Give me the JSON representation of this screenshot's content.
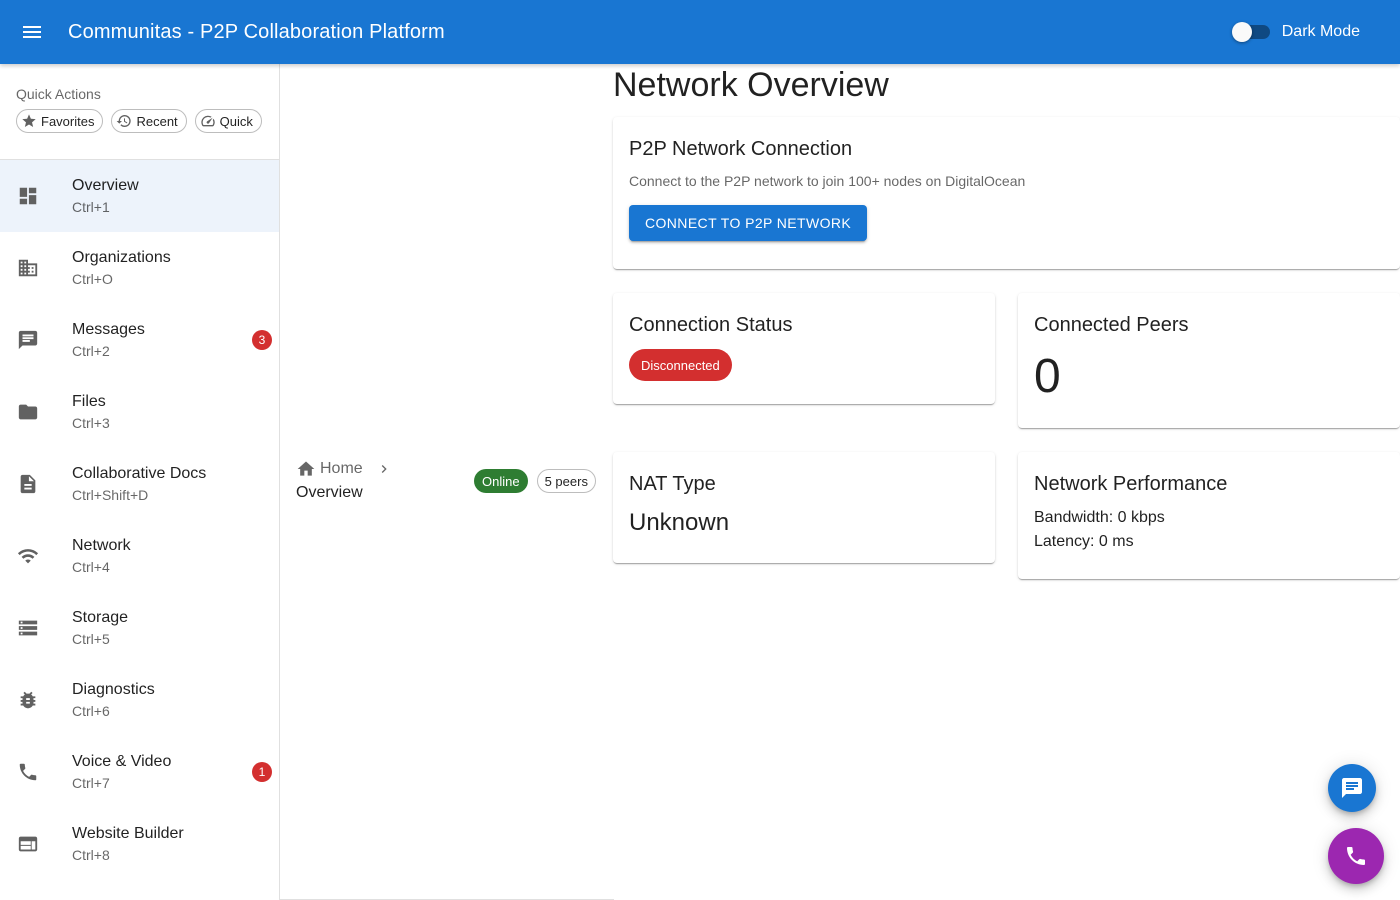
{
  "app": {
    "title": "Communitas - P2P Collaboration Platform",
    "menu_icon": "menu-icon",
    "dark_mode_label": "Dark Mode",
    "dark_mode_on": false,
    "primary_color": "#1976d2"
  },
  "quick_actions": {
    "title": "Quick Actions",
    "chips": [
      {
        "label": "Favorites",
        "icon": "star-icon"
      },
      {
        "label": "Recent",
        "icon": "history-icon"
      },
      {
        "label": "Quick",
        "icon": "speed-icon"
      }
    ]
  },
  "sidebar": {
    "items": [
      {
        "label": "Overview",
        "shortcut": "Ctrl+1",
        "icon": "dashboard-icon",
        "active": true
      },
      {
        "label": "Organizations",
        "shortcut": "Ctrl+O",
        "icon": "business-icon"
      },
      {
        "label": "Messages",
        "shortcut": "Ctrl+2",
        "icon": "chat-icon",
        "badge": "3"
      },
      {
        "label": "Files",
        "shortcut": "Ctrl+3",
        "icon": "folder-icon"
      },
      {
        "label": "Collaborative Docs",
        "shortcut": "Ctrl+Shift+D",
        "icon": "document-icon"
      },
      {
        "label": "Network",
        "shortcut": "Ctrl+4",
        "icon": "network-icon"
      },
      {
        "label": "Storage",
        "shortcut": "Ctrl+5",
        "icon": "storage-icon"
      },
      {
        "label": "Diagnostics",
        "shortcut": "Ctrl+6",
        "icon": "bug-icon"
      },
      {
        "label": "Voice & Video",
        "shortcut": "Ctrl+7",
        "icon": "phone-icon",
        "badge": "1"
      },
      {
        "label": "Website Builder",
        "shortcut": "Ctrl+8",
        "icon": "web-icon"
      }
    ]
  },
  "breadcrumb": {
    "home": "Home",
    "current": "Overview"
  },
  "status": {
    "online": "Online",
    "peers": "5 peers"
  },
  "main": {
    "title": "Network Overview",
    "p2p_card": {
      "title": "P2P Network Connection",
      "description": "Connect to the P2P network to join 100+ nodes on DigitalOcean",
      "button": "CONNECT TO P2P NETWORK"
    },
    "connection_status": {
      "title": "Connection Status",
      "value": "Disconnected"
    },
    "connected_peers": {
      "title": "Connected Peers",
      "value": "0"
    },
    "nat_type": {
      "title": "NAT Type",
      "value": "Unknown"
    },
    "network_performance": {
      "title": "Network Performance",
      "bandwidth": "Bandwidth: 0 kbps",
      "latency": "Latency: 0 ms"
    }
  },
  "fabs": [
    {
      "icon": "chat-icon",
      "color": "#1976d2"
    },
    {
      "icon": "phone-icon",
      "color": "#9c27b0"
    }
  ]
}
